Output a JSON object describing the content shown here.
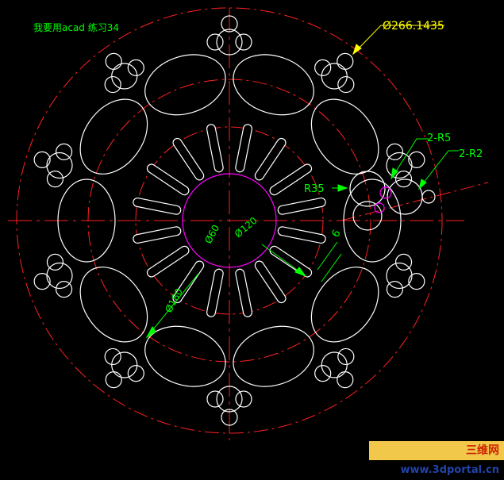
{
  "header": {
    "label": "我要用acad 练习34"
  },
  "dimensions": {
    "outer_diameter": "Ø266.1435",
    "dia_180": "Ø180",
    "dia_120": "Ø120",
    "dia_60": "Ø60",
    "radius_35": "R35",
    "radius_5": "2-R5",
    "radius_2": "2-R2",
    "slot_width": "6"
  },
  "colors": {
    "background": "#000000",
    "geometry": "#ffffff",
    "centerline": "#ff2020",
    "dimension": "#00ff00",
    "leader": "#ffff00",
    "hub": "#ff00ff"
  },
  "watermark": {
    "cn": "三维网",
    "url": "www.3dportal.cn"
  }
}
